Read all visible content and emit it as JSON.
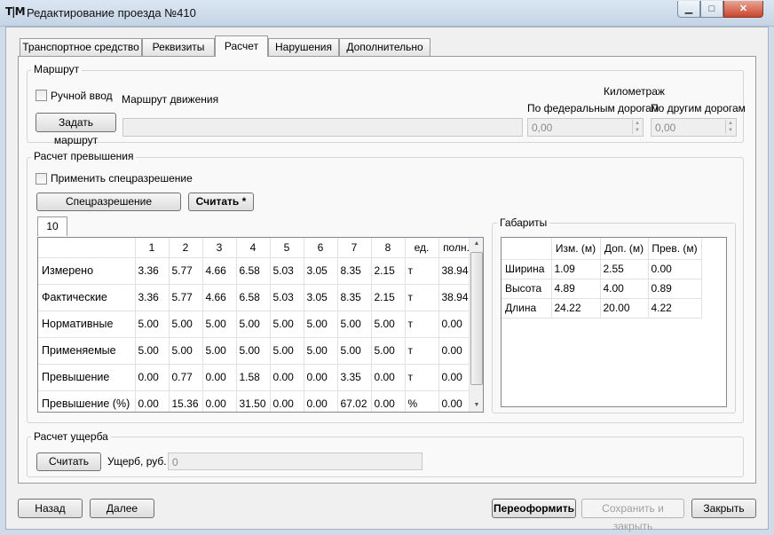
{
  "window": {
    "app_icon": "T|M",
    "title": "Редактирование проезда №410"
  },
  "tabs": [
    "Транспортное средство",
    "Реквизиты",
    "Расчет",
    "Нарушения",
    "Дополнительно"
  ],
  "route": {
    "group_label": "Маршрут",
    "manual_checkbox_label": "Ручной ввод",
    "set_route_button": "Задать маршрут",
    "route_label": "Маршрут движения",
    "route_value": "",
    "km_label": "Километраж",
    "federal_label": "По федеральным дорогам",
    "other_label": "По другим дорогам",
    "federal_value": "0,00",
    "other_value": "0,00"
  },
  "excess": {
    "group_label": "Расчет превышения",
    "permit_checkbox_label": "Применить спецразрешение",
    "permit_button": "Спецразрешение",
    "calc_button": "Считать *",
    "subtab": "10",
    "columns": [
      "1",
      "2",
      "3",
      "4",
      "5",
      "6",
      "7",
      "8",
      "ед.",
      "полн."
    ],
    "rows": [
      {
        "label": "Измерено",
        "cells": [
          "3.36",
          "5.77",
          "4.66",
          "6.58",
          "5.03",
          "3.05",
          "8.35",
          "2.15",
          "т",
          "38.94"
        ]
      },
      {
        "label": "Фактические",
        "cells": [
          "3.36",
          "5.77",
          "4.66",
          "6.58",
          "5.03",
          "3.05",
          "8.35",
          "2.15",
          "т",
          "38.94"
        ]
      },
      {
        "label": "Нормативные",
        "cells": [
          "5.00",
          "5.00",
          "5.00",
          "5.00",
          "5.00",
          "5.00",
          "5.00",
          "5.00",
          "т",
          "0.00"
        ]
      },
      {
        "label": "Применяемые",
        "cells": [
          "5.00",
          "5.00",
          "5.00",
          "5.00",
          "5.00",
          "5.00",
          "5.00",
          "5.00",
          "т",
          "0.00"
        ]
      },
      {
        "label": "Превышение",
        "cells": [
          "0.00",
          "0.77",
          "0.00",
          "1.58",
          "0.00",
          "0.00",
          "3.35",
          "0.00",
          "т",
          "0.00"
        ]
      },
      {
        "label": "Превышение (%)",
        "cells": [
          "0.00",
          "15.36",
          "0.00",
          "31.50",
          "0.00",
          "0.00",
          "67.02",
          "0.00",
          "%",
          "0.00"
        ]
      }
    ]
  },
  "dimensions": {
    "group_label": "Габариты",
    "columns": [
      "Изм. (м)",
      "Доп. (м)",
      "Прев. (м)"
    ],
    "rows": [
      {
        "label": "Ширина",
        "cells": [
          "1.09",
          "2.55",
          "0.00"
        ]
      },
      {
        "label": "Высота",
        "cells": [
          "4.89",
          "4.00",
          "0.89"
        ]
      },
      {
        "label": "Длина",
        "cells": [
          "24.22",
          "20.00",
          "4.22"
        ]
      }
    ]
  },
  "damage": {
    "group_label": "Расчет ущерба",
    "calc_button": "Считать",
    "damage_label": "Ущерб, руб.",
    "damage_value": "0"
  },
  "footer": {
    "back": "Назад",
    "next": "Далее",
    "reformat": "Переоформить",
    "save_close": "Сохранить и закрыть",
    "close": "Закрыть"
  }
}
